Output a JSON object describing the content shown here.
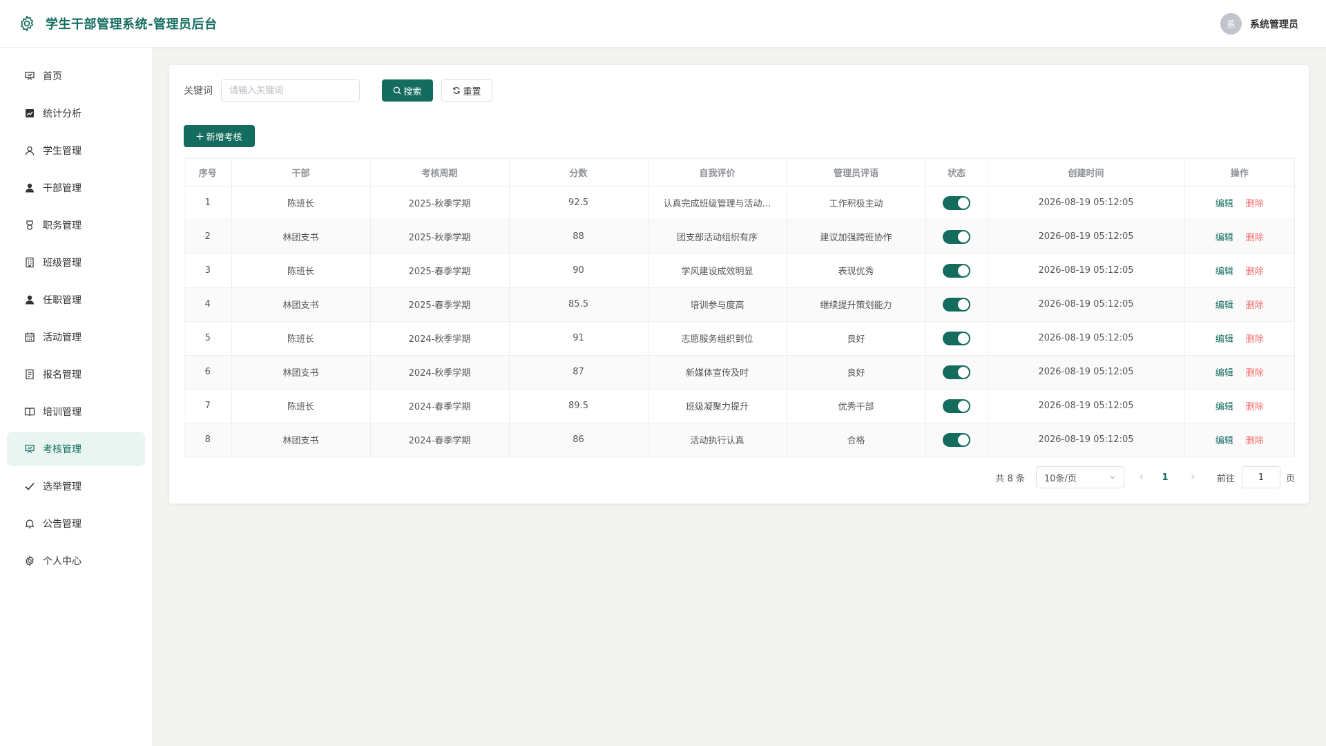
{
  "header": {
    "title": "学生干部管理系统-管理员后台",
    "user_avatar_text": "系",
    "user_name": "系统管理员"
  },
  "sidebar": {
    "items": [
      {
        "label": "首页",
        "icon": "presentation-icon"
      },
      {
        "label": "统计分析",
        "icon": "chart-icon"
      },
      {
        "label": "学生管理",
        "icon": "user-outline-icon"
      },
      {
        "label": "干部管理",
        "icon": "user-filled-icon"
      },
      {
        "label": "职务管理",
        "icon": "medal-icon"
      },
      {
        "label": "班级管理",
        "icon": "building-icon"
      },
      {
        "label": "任职管理",
        "icon": "user-filled-icon"
      },
      {
        "label": "活动管理",
        "icon": "calendar-icon"
      },
      {
        "label": "报名管理",
        "icon": "document-icon"
      },
      {
        "label": "培训管理",
        "icon": "book-icon"
      },
      {
        "label": "考核管理",
        "icon": "presentation-icon"
      },
      {
        "label": "选举管理",
        "icon": "check-icon"
      },
      {
        "label": "公告管理",
        "icon": "bell-icon"
      },
      {
        "label": "个人中心",
        "icon": "gear-icon"
      }
    ],
    "active_index": 10
  },
  "search": {
    "label": "关键词",
    "placeholder": "请输入关键词",
    "value": "",
    "search_label": "搜索",
    "reset_label": "重置"
  },
  "toolbar": {
    "add_label": "新增考核"
  },
  "table": {
    "columns": [
      "序号",
      "干部",
      "考核周期",
      "分数",
      "自我评价",
      "管理员评语",
      "状态",
      "创建时间",
      "操作"
    ],
    "edit_label": "编辑",
    "delete_label": "删除",
    "rows": [
      {
        "no": "1",
        "cadre": "陈班长",
        "period": "2025-秋季学期",
        "score": "92.5",
        "self_eval": "认真完成班级管理与活动…",
        "comment": "工作积极主动",
        "status_on": true,
        "created": "2026-08-19 05:12:05"
      },
      {
        "no": "2",
        "cadre": "林团支书",
        "period": "2025-秋季学期",
        "score": "88",
        "self_eval": "团支部活动组织有序",
        "comment": "建议加强跨班协作",
        "status_on": true,
        "created": "2026-08-19 05:12:05"
      },
      {
        "no": "3",
        "cadre": "陈班长",
        "period": "2025-春季学期",
        "score": "90",
        "self_eval": "学风建设成效明显",
        "comment": "表现优秀",
        "status_on": true,
        "created": "2026-08-19 05:12:05"
      },
      {
        "no": "4",
        "cadre": "林团支书",
        "period": "2025-春季学期",
        "score": "85.5",
        "self_eval": "培训参与度高",
        "comment": "继续提升策划能力",
        "status_on": true,
        "created": "2026-08-19 05:12:05"
      },
      {
        "no": "5",
        "cadre": "陈班长",
        "period": "2024-秋季学期",
        "score": "91",
        "self_eval": "志愿服务组织到位",
        "comment": "良好",
        "status_on": true,
        "created": "2026-08-19 05:12:05"
      },
      {
        "no": "6",
        "cadre": "林团支书",
        "period": "2024-秋季学期",
        "score": "87",
        "self_eval": "新媒体宣传及时",
        "comment": "良好",
        "status_on": true,
        "created": "2026-08-19 05:12:05"
      },
      {
        "no": "7",
        "cadre": "陈班长",
        "period": "2024-春季学期",
        "score": "89.5",
        "self_eval": "班级凝聚力提升",
        "comment": "优秀干部",
        "status_on": true,
        "created": "2026-08-19 05:12:05"
      },
      {
        "no": "8",
        "cadre": "林团支书",
        "period": "2024-春季学期",
        "score": "86",
        "self_eval": "活动执行认真",
        "comment": "合格",
        "status_on": true,
        "created": "2026-08-19 05:12:05"
      }
    ]
  },
  "pagination": {
    "total_text": "共 8 条",
    "page_size": "10条/页",
    "current_page": "1",
    "goto_label": "前往",
    "goto_value": "1",
    "page_suffix": "页"
  },
  "colors": {
    "primary": "#136c5e",
    "danger": "#f56c6c",
    "active_bg": "#e8f5f0"
  }
}
